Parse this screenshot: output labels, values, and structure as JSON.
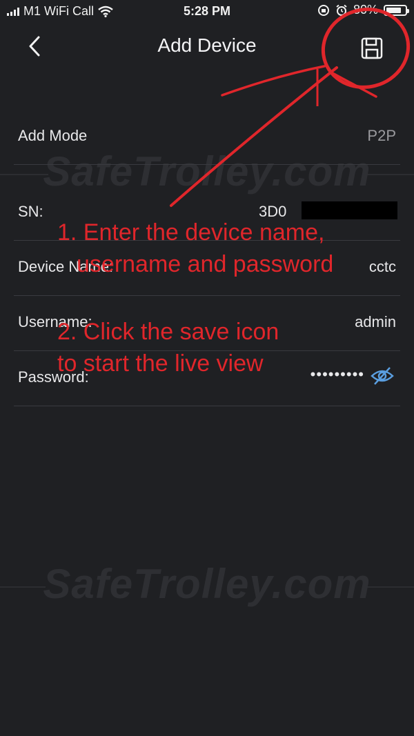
{
  "status_bar": {
    "carrier": "M1 WiFi Call",
    "time": "5:28 PM",
    "battery_text": "80%",
    "battery_level": 0.8,
    "icons": [
      "signal-bars-icon",
      "wifi-icon",
      "orientation-lock-icon",
      "alarm-icon",
      "battery-icon"
    ]
  },
  "header": {
    "title": "Add Device",
    "back_icon": "chevron-left-icon",
    "save_icon": "floppy-save-icon"
  },
  "form": {
    "add_mode": {
      "label": "Add Mode",
      "value": "P2P"
    },
    "sn": {
      "label": "SN:",
      "value": "3D0"
    },
    "device_name": {
      "label": "Device Name:",
      "value": "cctc"
    },
    "username": {
      "label": "Username:",
      "value": "admin"
    },
    "password": {
      "label": "Password:",
      "value": "•••••••••",
      "toggle_icon": "eye-hidden-icon"
    }
  },
  "watermark": {
    "text": "SafeTrolley.com"
  },
  "annotations": {
    "step1_line1": "1. Enter the device name,",
    "step1_line2": "username and password",
    "step2_line1": "2. Click the save icon",
    "step2_line2": "to start the live view"
  },
  "colors": {
    "background": "#1f2023",
    "annotation": "#e0262b",
    "divider": "#3a3b40",
    "eye_icon": "#5a9ee0"
  }
}
